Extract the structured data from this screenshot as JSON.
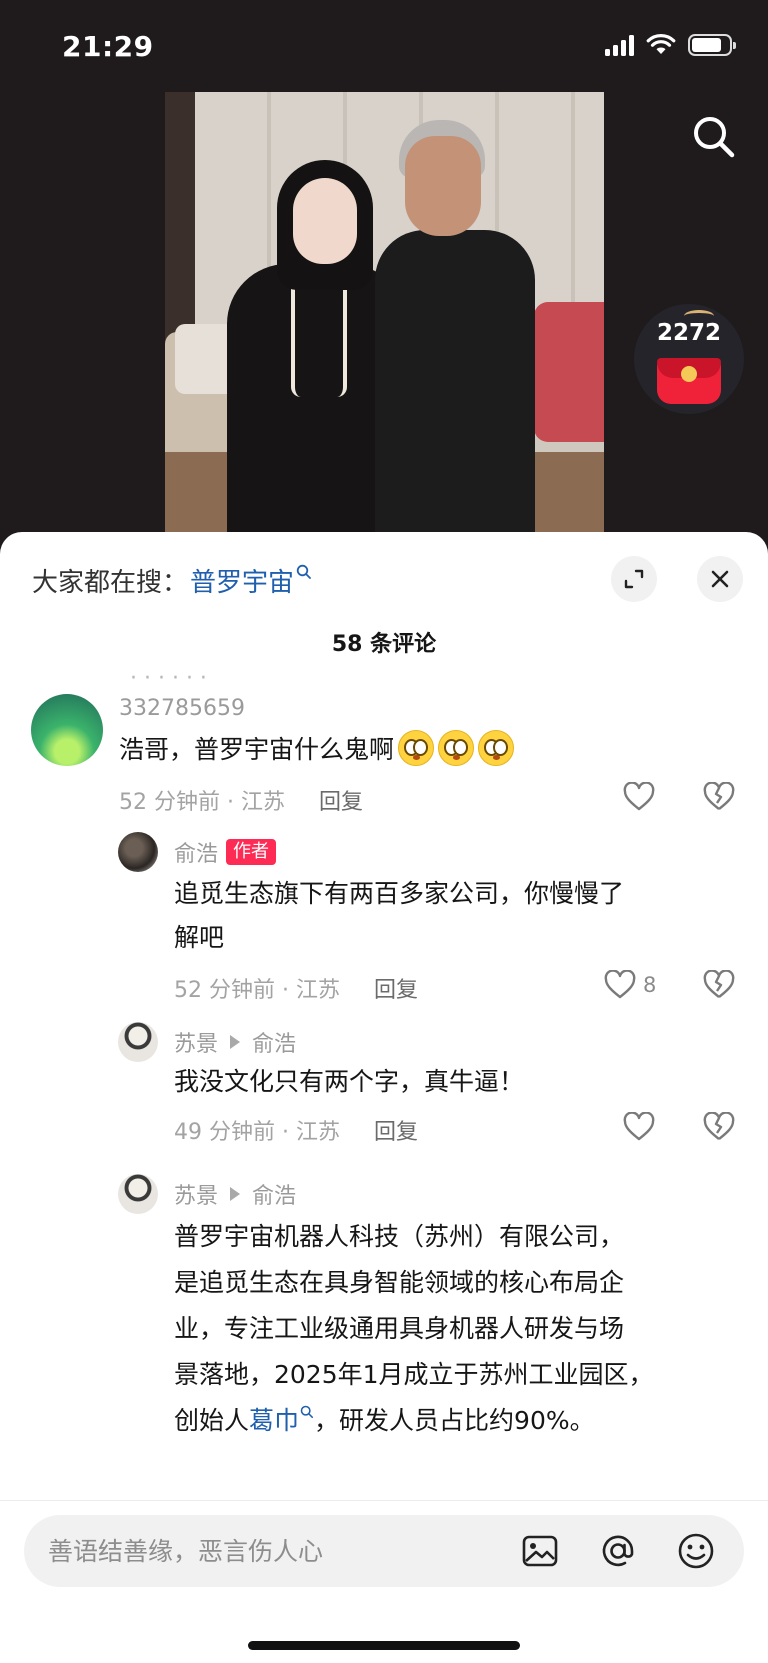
{
  "status_bar": {
    "time": "21:29",
    "battery_level": 0.8
  },
  "video": {
    "search_icon": "search-icon",
    "red_packet_count": "2272"
  },
  "panel": {
    "hot_search_label": "大家都在搜：",
    "hot_search_term": "普罗宇宙",
    "comment_count": "58 条评论",
    "expand_icon": "expand-icon",
    "close_icon": "close-icon"
  },
  "comments": [
    {
      "user": "332785659",
      "text": "浩哥，普罗宇宙什么鬼啊",
      "emoji_count": 3,
      "time": "52 分钟前 · 江苏",
      "reply": "回复",
      "likes": ""
    },
    {
      "user": "俞浩",
      "badge": "作者",
      "text_line1": "追觅生态旗下有两百多家公司，你慢慢了",
      "text_line2": "解吧",
      "time": "52 分钟前 · 江苏",
      "reply": "回复",
      "likes": "8"
    },
    {
      "user": "苏景",
      "reply_to": "俞浩",
      "text": "我没文化只有两个字，真牛逼！",
      "time": "49 分钟前 · 江苏",
      "reply": "回复",
      "likes": ""
    },
    {
      "user": "苏景",
      "reply_to": "俞浩",
      "line1": "普罗宇宙机器人科技（苏州）有限公司，",
      "line2": "是追觅生态在具身智能领域的核心布局企",
      "line3": "业，专注工业级通用具身机器人研发与场",
      "line4": "景落地，2025年1月成立于苏州工业园区，",
      "line5_pre": "创始人",
      "line5_link": "葛巾",
      "line5_post": "，研发人员占比约90%。"
    }
  ],
  "input": {
    "placeholder": "善语结善缘，恶言伤人心",
    "image_icon": "image-icon",
    "at_icon": "at-icon",
    "emoji_icon": "emoji-icon"
  },
  "colors": {
    "accent_link": "#1f5fae",
    "author_badge": "#fe2c55",
    "background_dark": "#1f1b1c"
  }
}
